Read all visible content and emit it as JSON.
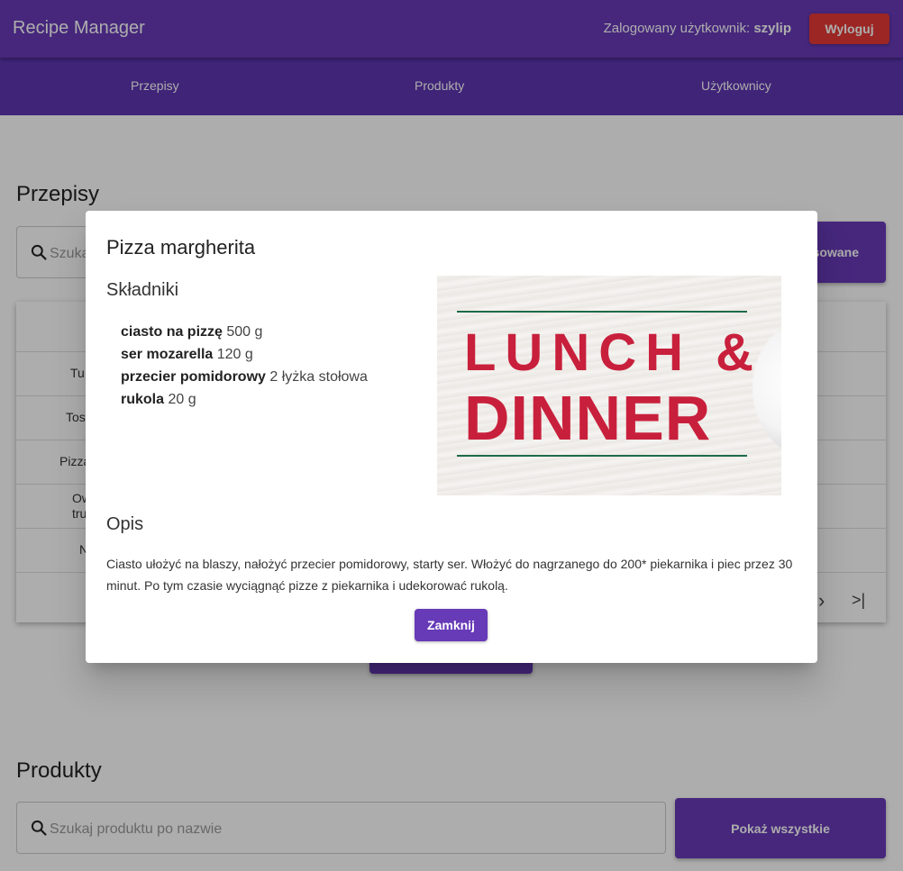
{
  "header": {
    "app_title": "Recipe Manager",
    "user_prefix": "Zalogowany użytkownik:",
    "username": "szylip",
    "logout_label": "Wyloguj"
  },
  "nav": {
    "recipes": "Przepisy",
    "products": "Produkty",
    "users": "Użytkownicy"
  },
  "recipes_section": {
    "title": "Przepisy",
    "search_placeholder": "Szukaj",
    "filter_button_partial": "sowane",
    "rows": [
      "Tu",
      "Tos",
      "Pizza",
      "Ow tru",
      "N"
    ]
  },
  "products_section": {
    "title": "Produkty",
    "search_placeholder": "Szukaj produktu po nazwie",
    "show_all_label": "Pokaż wszystkie"
  },
  "pager": {
    "next": "›",
    "last": ">|"
  },
  "modal": {
    "title": "Pizza margherita",
    "ingredients_title": "Składniki",
    "ingredients": [
      {
        "name": "ciasto na pizzę",
        "amount": "500 g"
      },
      {
        "name": "ser mozarella",
        "amount": "120 g"
      },
      {
        "name": "przecier pomidorowy",
        "amount": "2 łyżka stołowa"
      },
      {
        "name": "rukola",
        "amount": "20 g"
      }
    ],
    "image_text_line1": "LUNCH &",
    "image_text_line2": "DINNER",
    "description_title": "Opis",
    "description": "Ciasto ułożyć na blaszy, nałożyć przecier pomidorowy, starty ser. Włożyć do nagrzanego do 200* piekarnika i piec przez 30 minut. Po tym czasie wyciągnąć pizze z piekarnika i udekorować rukolą.",
    "close_label": "Zamknij"
  },
  "colors": {
    "primary": "#673ab7",
    "nav": "#5e35b1",
    "danger": "#e53935",
    "image_text": "#c8203c"
  }
}
